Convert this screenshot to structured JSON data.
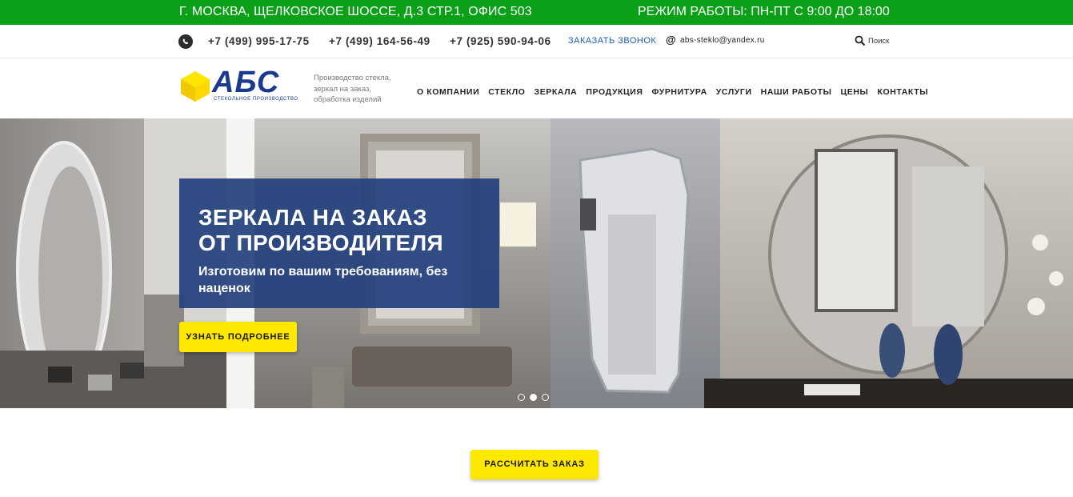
{
  "topbar": {
    "address": "Г. МОСКВА, ЩЕЛКОВСКОЕ ШОССЕ, Д.3 СТР.1, ОФИС 503",
    "hours": "РЕЖИМ РАБОТЫ: ПН-ПТ С 9:00 ДО 18:00",
    "bg_color": "#0ca019"
  },
  "contacts": {
    "whatsapp_icon": "whatsapp-icon",
    "phones": [
      "+7 (499) 995-17-75",
      "+7 (499) 164-56-49",
      "+7 (925) 590-94-06"
    ],
    "callback_label": "ЗАКАЗАТЬ ЗВОНОК",
    "email_symbol": "@",
    "email": "abs-steklo@yandex.ru",
    "search_label": "Поиск"
  },
  "header": {
    "logo_text": "АБС",
    "logo_sub": "СТЕКОЛЬНОЕ ПРОИЗВОДСТВО",
    "tagline": "Производство стекла, зеркал на заказ, обработка изделий",
    "nav": [
      "О КОМПАНИИ",
      "СТЕКЛО",
      "ЗЕРКАЛА",
      "ПРОДУКЦИЯ",
      "ФУРНИТУРА",
      "УСЛУГИ",
      "НАШИ РАБОТЫ",
      "ЦЕНЫ",
      "КОНТАКТЫ"
    ]
  },
  "hero": {
    "heading_line1": "ЗЕРКАЛА НА ЗАКАЗ",
    "heading_line2": "ОТ ПРОИЗВОДИТЕЛЯ",
    "subtitle": "Изготовим по вашим требованиям, без наценок",
    "cta_label": "УЗНАТЬ ПОДРОБНЕЕ",
    "slides_total": 3,
    "active_slide": 2
  },
  "calculate": {
    "label": "РАССЧИТАТЬ ЗАКАЗ"
  },
  "colors": {
    "accent_yellow": "#ffe800",
    "brand_blue": "#1b3a8f",
    "promo_blue": "#23407d",
    "link_blue": "#1d5db3"
  }
}
